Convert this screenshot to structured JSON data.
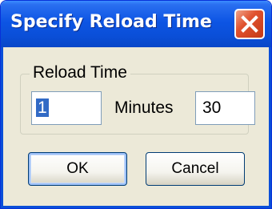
{
  "window": {
    "title": "Specify Reload Time"
  },
  "group": {
    "label": "Reload Time"
  },
  "fields": {
    "hours_value": "1",
    "minutes_label": "Minutes",
    "minutes_value": "30"
  },
  "buttons": {
    "ok_label": "OK",
    "cancel_label": "Cancel"
  },
  "icons": {
    "close": "close-icon"
  },
  "colors": {
    "titlebar": "#0a4fd8",
    "close_button": "#e0522f",
    "dialog_background": "#ece9d8",
    "selection": "#316ac5"
  }
}
